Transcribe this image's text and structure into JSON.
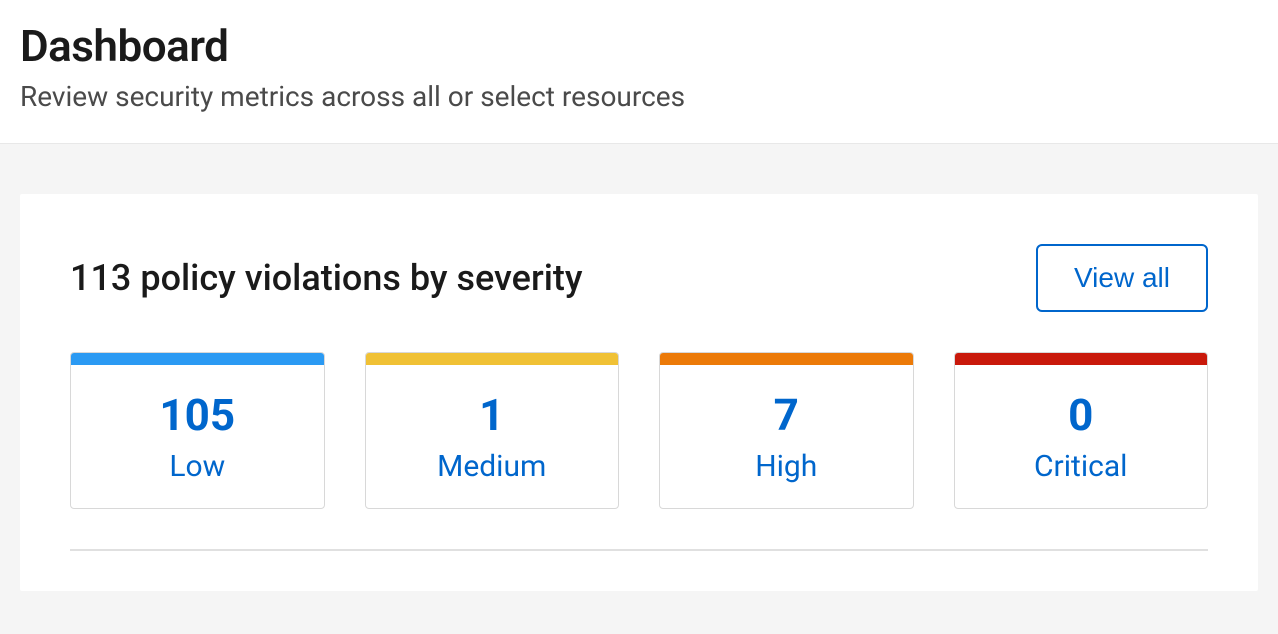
{
  "header": {
    "title": "Dashboard",
    "subtitle": "Review security metrics across all or select resources"
  },
  "violations_card": {
    "title": "113 policy violations by severity",
    "view_all_label": "View all",
    "severities": [
      {
        "count": "105",
        "label": "Low",
        "color": "#2b9af3"
      },
      {
        "count": "1",
        "label": "Medium",
        "color": "#f0c135"
      },
      {
        "count": "7",
        "label": "High",
        "color": "#ec7a08"
      },
      {
        "count": "0",
        "label": "Critical",
        "color": "#c9190b"
      }
    ]
  }
}
